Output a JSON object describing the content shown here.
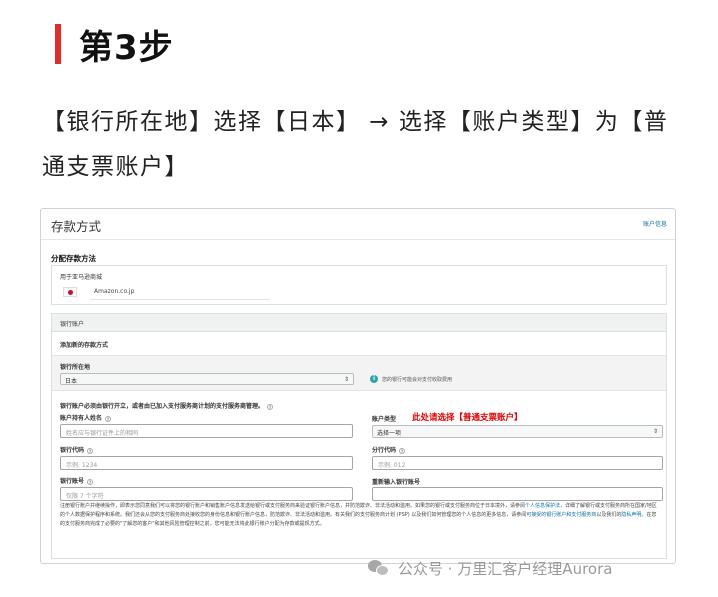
{
  "step": {
    "title": "第3步"
  },
  "instruction": {
    "text": "【银行所在地】选择【日本】 → 选择【账户类型】为【普通支票账户】"
  },
  "form": {
    "title": "存款方式",
    "help_link": "账户信息",
    "section_heading": "分配存款方法",
    "store": {
      "label": "用于亚马逊商城",
      "marketplace": "Amazon.co.jp"
    },
    "bank": {
      "header": "银行账户",
      "add_new": "添加新的存款方式",
      "location_label": "银行所在地",
      "location_value": "日本",
      "location_info": "您的银行可能会对支付收取费用",
      "note": "银行账户必须由银行开立，或者由已加入支付服务商计划的支付服务商管理。",
      "account_holder_label": "账户持有人姓名",
      "account_holder_placeholder": "姓名应与银行证件上的相同",
      "account_type_label": "账户类型",
      "account_type_value": "选择一项",
      "annotation": "此处请选择【普通支票账户】",
      "bank_code_label": "银行代码",
      "bank_code_placeholder": "示例: 1234",
      "branch_code_label": "分行代码",
      "branch_code_placeholder": "示例: 012",
      "account_number_label": "银行账号",
      "account_number_placeholder": "仅限 7 个字符",
      "reenter_label": "重新输入银行账号",
      "legal_1": "注册银行账户并继续操作，即表示您同意我们可以将您的银行账户和销售账户信息发送给银行或支付服务商来验证银行账户信息，并防范欺诈、非法活动和滥用。如果您的银行或支付服务商位于日本境外，请参阅",
      "legal_link_1": "个人信息保护法",
      "legal_2": "，详细了解银行或支付服务商所在国家/地区的个人数据保护程序和系统。我们还会从您的支付服务商处接收您的身份信息和银行账户信息，防范欺诈、非法活动和滥用。有关我们的支付服务商计划 (PSP) 以及我们如何管理您的个人信息的更多信息，请参阅",
      "legal_link_2": "可接受的银行账户和支付服务商",
      "legal_3": "以及我们的",
      "legal_link_3": "隐私声明",
      "legal_4": "。在您的支付服务商完成了必要的\"了解您的客户\"和其他风险管理控制之前，您可能无法将此银行账户分配为存款或提现方式。"
    }
  },
  "watermark": {
    "text": "公众号 · 万里汇客户经理Aurora"
  }
}
